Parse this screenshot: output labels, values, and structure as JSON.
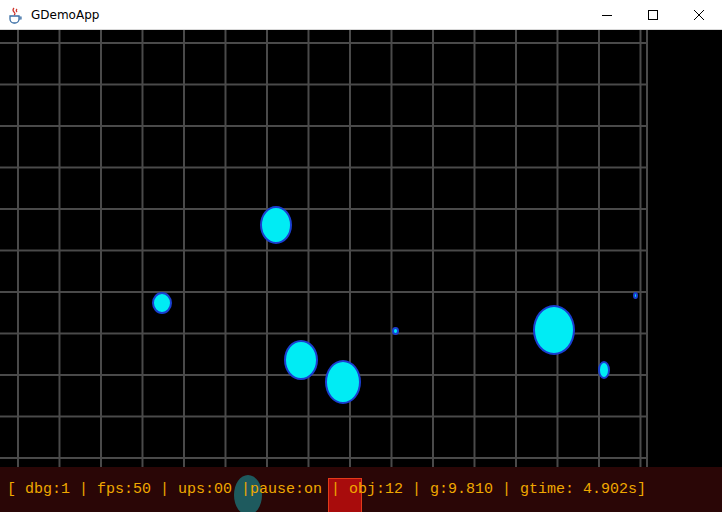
{
  "window": {
    "title": "GDemoApp"
  },
  "status_bar": {
    "text": "[ dbg:1 | fps:50 | ups:00 |pause:on | obj:12 | g:9.810 | gtime: 4.902s]"
  }
}
